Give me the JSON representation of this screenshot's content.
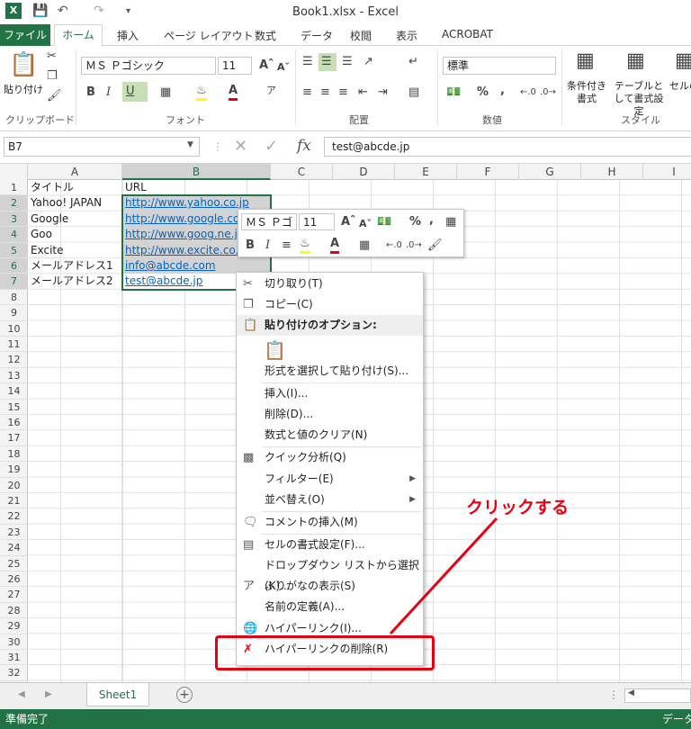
{
  "titlebar": {
    "title": "Book1.xlsx - Excel"
  },
  "tabs": [
    "ファイル",
    "ホーム",
    "挿入",
    "ページ レイアウト",
    "数式",
    "データ",
    "校閲",
    "表示",
    "ACROBAT"
  ],
  "ribbon": {
    "paste_label": "貼り付け",
    "font_name": "ＭＳ Ｐゴシック",
    "font_size": "11",
    "number_format": "標準",
    "bold": "B",
    "italic": "I",
    "underline": "U",
    "percent": "%",
    "comma": ",",
    "cond_format": "条件付き書式",
    "table_format": "テーブルとして書式設定",
    "cell_style": "セルのスタイル",
    "groups": {
      "clipboard": "クリップボード",
      "font": "フォント",
      "alignment": "配置",
      "number": "数値",
      "style": "スタイル"
    }
  },
  "formula_bar": {
    "name_box": "B7",
    "fx": "fx",
    "value": "test@abcde.jp"
  },
  "columns": [
    "A",
    "B",
    "C",
    "D",
    "E",
    "F",
    "G",
    "H",
    "I"
  ],
  "rows": [
    "1",
    "2",
    "3",
    "4",
    "5",
    "6",
    "7",
    "8",
    "9",
    "10",
    "11",
    "12",
    "13",
    "14",
    "15",
    "16",
    "17",
    "18",
    "19",
    "20",
    "21",
    "22",
    "23",
    "24",
    "25",
    "26",
    "27",
    "28",
    "29",
    "30",
    "31",
    "32"
  ],
  "cells": [
    {
      "a": "タイトル",
      "b": "URL"
    },
    {
      "a": "Yahoo! JAPAN",
      "b": "http://www.yahoo.co.jp"
    },
    {
      "a": "Google",
      "b": "http://www.google.co.jp"
    },
    {
      "a": "Goo",
      "b": "http://www.goog.ne.jp"
    },
    {
      "a": "Excite",
      "b": "http://www.excite.co.jp"
    },
    {
      "a": "メールアドレス1",
      "b": "info@abcde.com"
    },
    {
      "a": "メールアドレス2",
      "b": "test@abcde.jp"
    }
  ],
  "minibar": {
    "font_name": "ＭＳ Ｐゴ",
    "font_size": "11",
    "bold": "B",
    "italic": "I",
    "percent": "%",
    "comma": ","
  },
  "context_menu": {
    "cut": "切り取り(T)",
    "copy": "コピー(C)",
    "paste_options": "貼り付けのオプション:",
    "paste_special": "形式を選択して貼り付け(S)...",
    "insert": "挿入(I)...",
    "delete": "削除(D)...",
    "clear": "数式と値のクリア(N)",
    "quick_analysis": "クイック分析(Q)",
    "filter": "フィルター(E)",
    "sort": "並べ替え(O)",
    "insert_comment": "コメントの挿入(M)",
    "format_cells": "セルの書式設定(F)...",
    "dropdown": "ドロップダウン リストから選択(K)...",
    "phonetic": "ふりがなの表示(S)",
    "define_name": "名前の定義(A)...",
    "hyperlink": "ハイパーリンク(I)...",
    "remove_hyperlink": "ハイパーリンクの削除(R)"
  },
  "annotation": {
    "text": "クリックする"
  },
  "sheet": {
    "tab": "Sheet1"
  },
  "status": {
    "left": "準備完了",
    "right": "データ"
  },
  "colors": {
    "excel_green": "#217346",
    "link": "#0563c1",
    "annotation_red": "#e60012"
  }
}
